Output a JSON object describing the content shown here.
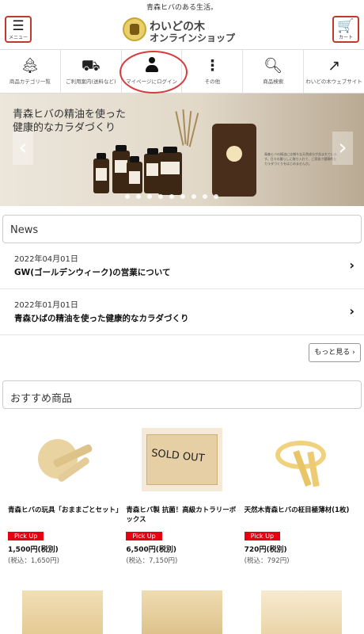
{
  "tagline": "青森ヒバのある生活。",
  "header": {
    "menu_label": "メニュー",
    "cart_label": "カート",
    "logo_line1": "わいどの木",
    "logo_line2": "オンラインショップ"
  },
  "nav": {
    "items": [
      {
        "label": "商品カテゴリ一覧",
        "icon": "tree-icon"
      },
      {
        "label": "ご利用案内(送料など)",
        "icon": "truck-icon"
      },
      {
        "label": "マイページにログイン",
        "icon": "person-icon"
      },
      {
        "label": "その他",
        "icon": "more-vertical-icon"
      },
      {
        "label": "商品検索",
        "icon": "search-icon"
      },
      {
        "label": "わいどの木ウェブサイト",
        "icon": "external-link-icon"
      }
    ]
  },
  "banner": {
    "line1": "青森ヒバの精油を使った",
    "line2": "健康的なカラダづくり",
    "small_text": "青森ヒバの精油には様々な天然成分が含まれています。日々の暮らしに取り入れて、ご家族で健康的なカラダづくりをはじめませんか。",
    "slide_count": 9
  },
  "news": {
    "heading": "News",
    "items": [
      {
        "date": "2022年04月01日",
        "title": "GW(ゴールデンウィーク)の営業について"
      },
      {
        "date": "2022年01月01日",
        "title": "青森ひばの精油を使った健康的なカラダづくり"
      }
    ],
    "more_label": "もっと見る"
  },
  "recommend": {
    "heading": "おすすめ商品",
    "pick_label": "Pick Up",
    "products": [
      {
        "name": "青森ヒバの玩具「おままごとセット」",
        "price": "1,500円(税別)",
        "tax_price": "(税込：1,650円)"
      },
      {
        "name": "青森ヒバ製 抗菌！高級カトラリーボックス",
        "price": "6,500円(税別)",
        "tax_price": "(税込：7,150円)",
        "sold_out": "SOLD OUT"
      },
      {
        "name": "天然木青森ヒバの柾目極薄材(1枚)",
        "price": "720円(税別)",
        "tax_price": "(税込：792円)"
      }
    ]
  },
  "colors": {
    "accent_red": "#c0392b",
    "pickup_red": "#e60012"
  }
}
